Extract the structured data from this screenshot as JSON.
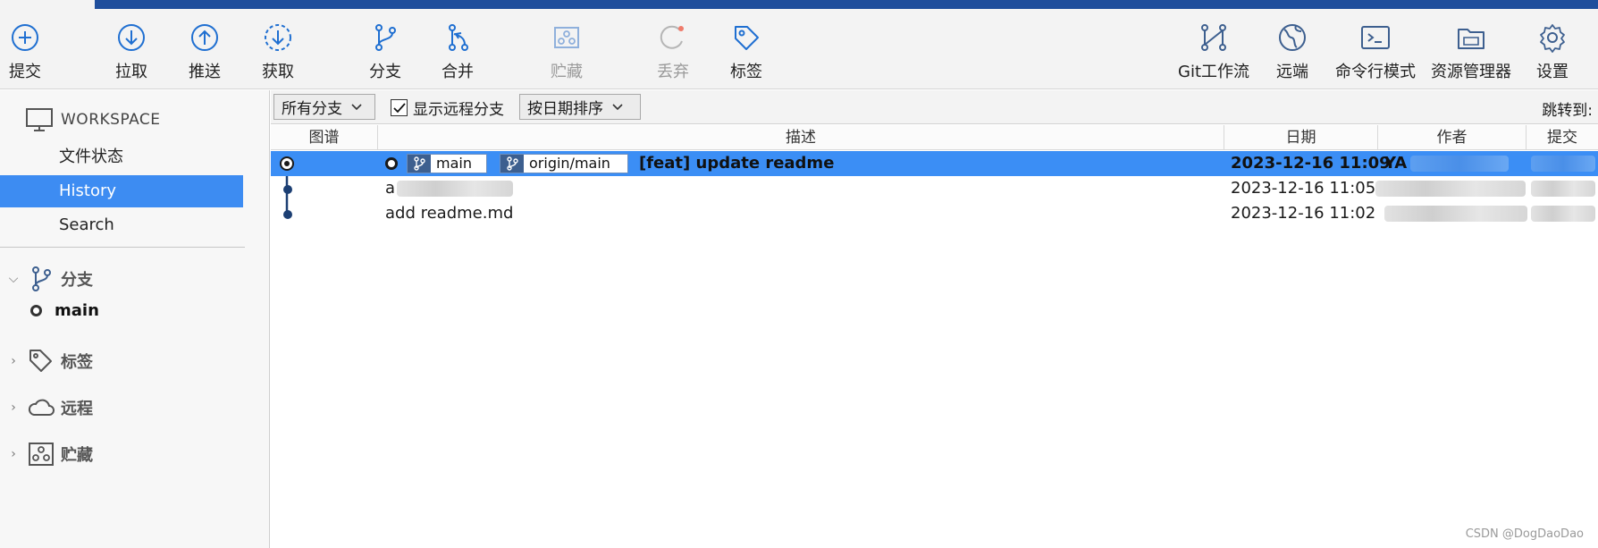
{
  "toolbar": {
    "commit": "提交",
    "pull": "拉取",
    "push": "推送",
    "fetch": "获取",
    "branch": "分支",
    "merge": "合并",
    "stash": "贮藏",
    "discard": "丢弃",
    "tag": "标签",
    "gitflow": "Git工作流",
    "remote": "远端",
    "terminal": "命令行模式",
    "explorer": "资源管理器",
    "settings": "设置"
  },
  "sidebar": {
    "workspace_title": "WORKSPACE",
    "items": [
      {
        "label": "文件状态",
        "active": false
      },
      {
        "label": "History",
        "active": true
      },
      {
        "label": "Search",
        "active": false
      }
    ],
    "groups": {
      "branches": "分支",
      "tags": "标签",
      "remotes": "远程",
      "stashes": "贮藏"
    },
    "current_branch": "main"
  },
  "filterbar": {
    "branch_filter": "所有分支",
    "show_remote_label": "显示远程分支",
    "show_remote_checked": true,
    "sort_order": "按日期排序",
    "jump_to": "跳转到:"
  },
  "columns": {
    "graph": "图谱",
    "description": "描述",
    "date": "日期",
    "author": "作者",
    "commit": "提交"
  },
  "commits": [
    {
      "refs": [
        "main",
        "origin/main"
      ],
      "message": "[feat] update readme",
      "date": "2023-12-16 11:09",
      "author": "YA",
      "selected": true
    },
    {
      "refs": [],
      "message": "a",
      "date": "2023-12-16 11:05",
      "author": "",
      "selected": false
    },
    {
      "refs": [],
      "message": "add readme.md",
      "date": "2023-12-16 11:02",
      "author": "",
      "selected": false
    }
  ],
  "watermark": "CSDN @DogDaoDao",
  "colors": {
    "accent": "#3d8cf2",
    "selected_row": "#3b8ef5",
    "titlebar": "#1f4e9c",
    "icon_blue": "#1f6fd1"
  }
}
